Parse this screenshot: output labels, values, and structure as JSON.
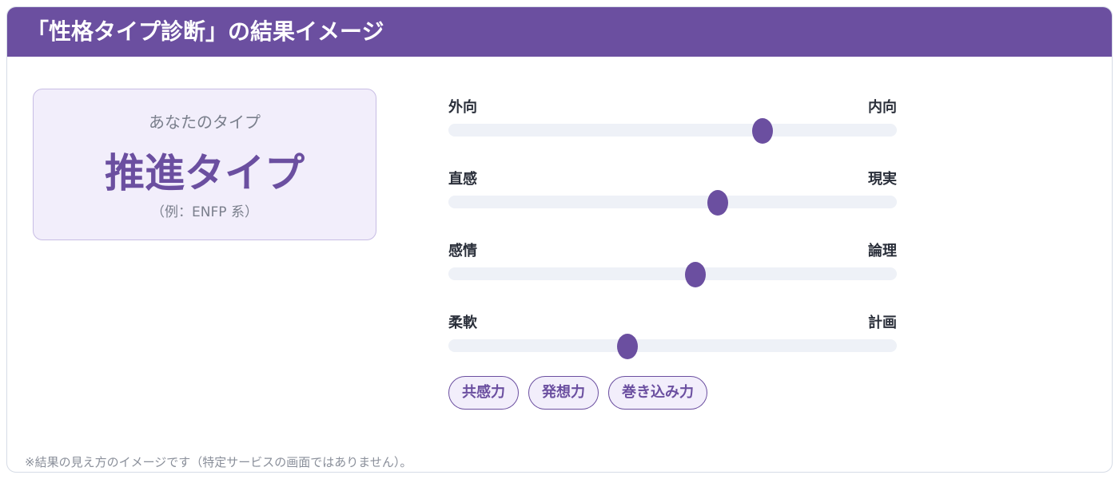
{
  "header": {
    "title": "「性格タイプ診断」の結果イメージ"
  },
  "type_card": {
    "caption": "あなたのタイプ",
    "type_name": "推進タイプ",
    "note": "（例：ENFP 系）"
  },
  "scales": [
    {
      "left_label": "外向",
      "right_label": "内向",
      "value": 0.7
    },
    {
      "left_label": "直感",
      "right_label": "現実",
      "value": 0.6
    },
    {
      "left_label": "感情",
      "right_label": "論理",
      "value": 0.55
    },
    {
      "left_label": "柔軟",
      "right_label": "計画",
      "value": 0.4
    }
  ],
  "tags": [
    "共感力",
    "発想力",
    "巻き込み力"
  ],
  "footnote": "※結果の見え方のイメージです（特定サービスの画面ではありません）。",
  "colors": {
    "accent": "#6b4fa0",
    "card_background": "#f2eefb",
    "track": "#eef1f7"
  }
}
